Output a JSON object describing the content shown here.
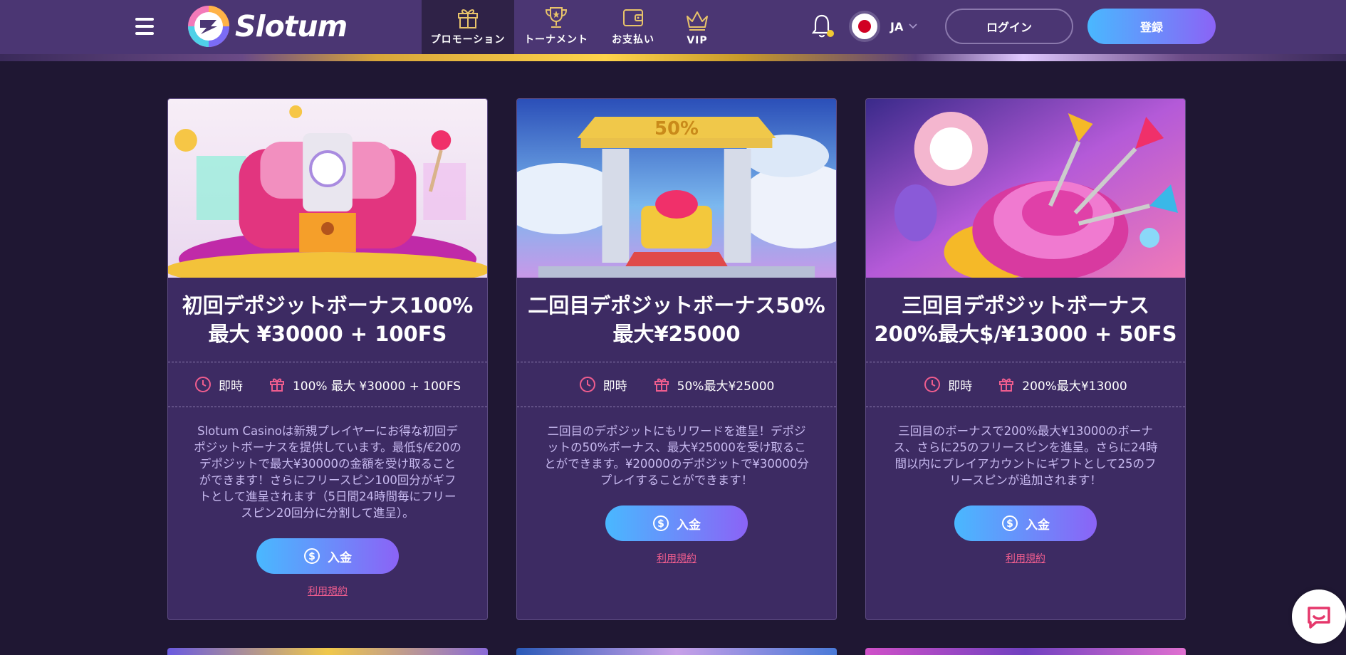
{
  "header": {
    "logo_text": "Slotum",
    "nav": [
      {
        "label": "プロモーション",
        "icon": "gift-icon",
        "active": true
      },
      {
        "label": "トーナメント",
        "icon": "trophy-icon",
        "active": false
      },
      {
        "label": "お支払い",
        "icon": "wallet-icon",
        "active": false
      },
      {
        "label": "VIP",
        "icon": "crown-icon",
        "active": false
      }
    ],
    "lang_code": "JA",
    "login_label": "ログイン",
    "register_label": "登録"
  },
  "promotions": [
    {
      "title_line1": "初回デポジットボーナス100%",
      "title_line2": "最大 ¥30000 + 100FS",
      "timing": "即時",
      "bonus": "100% 最大 ¥30000 + 100FS",
      "description": "Slotum Casinoは新規プレイヤーにお得な初回デポジットボーナスを提供しています。最低$/€20のデポジットで最大¥30000の金額を受け取ることができます！さらにフリースピン100回分がギフトとして進呈されます（5日間24時間毎にフリースピン20回分に分割して進呈）。",
      "deposit_label": "入金",
      "terms_label": "利用規約"
    },
    {
      "title_line1": "二回目デポジットボーナス50%",
      "title_line2": "最大¥25000",
      "timing": "即時",
      "bonus": "50%最大¥25000",
      "description": "二回目のデポジットにもリワードを進呈！デポジットの50%ボーナス、最大¥25000を受け取ることができます。¥20000のデポジットで¥30000分プレイすることができます！",
      "deposit_label": "入金",
      "terms_label": "利用規約"
    },
    {
      "title_line1": "三回目デポジットボーナス",
      "title_line2": "200%最大$/¥13000 + 50FS",
      "timing": "即時",
      "bonus": "200%最大¥13000",
      "description": "三回目のボーナスで200%最大¥13000のボーナス、さらに25のフリースピンを進呈。さらに24時間以内にプレイアカウントにギフトとして25のフリースピンが追加されます！",
      "deposit_label": "入金",
      "terms_label": "利用規約"
    }
  ],
  "colors": {
    "header_bg": "#4b3673",
    "page_bg": "#1f1733",
    "card_bg": "#3d2b63",
    "accent_pink": "#ef5d8e",
    "button_gradient_start": "#49b8ff",
    "button_gradient_end": "#8b63f6"
  }
}
